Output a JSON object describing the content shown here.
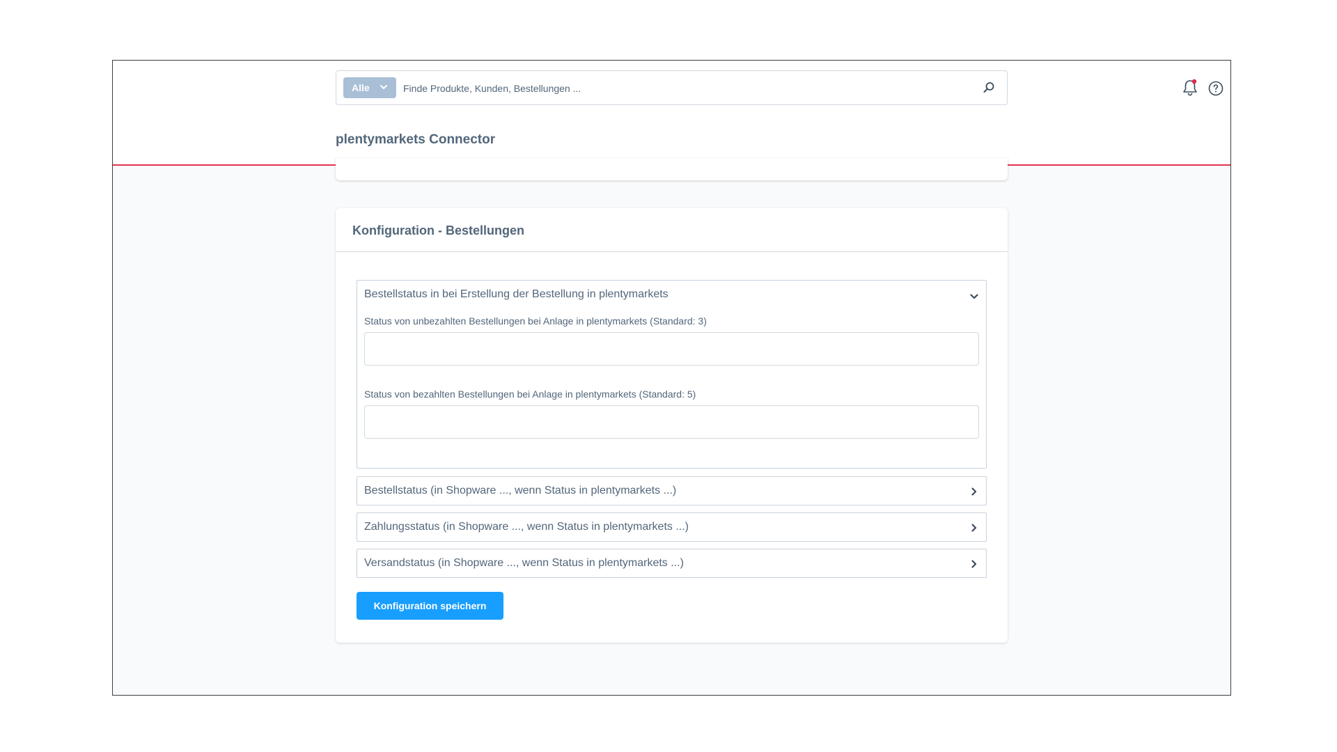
{
  "search": {
    "type_label": "Alle",
    "placeholder": "Finde Produkte, Kunden, Bestellungen ..."
  },
  "module": {
    "title": "plentymarkets Connector"
  },
  "card": {
    "title": "Konfiguration - Bestellungen",
    "open_panel": {
      "title": "Bestellstatus in bei Erstellung der Bestellung in plentymarkets",
      "fields": [
        {
          "label": "Status von unbezahlten Bestellungen bei Anlage in plentymarkets (Standard: 3)",
          "value": ""
        },
        {
          "label": "Status von bezahlten Bestellungen bei Anlage in plentymarkets (Standard: 5)",
          "value": ""
        }
      ]
    },
    "collapsed_panels": [
      {
        "title": "Bestellstatus (in Shopware ..., wenn Status in plentymarkets ...)"
      },
      {
        "title": "Zahlungsstatus (in Shopware ..., wenn Status in plentymarkets ...)"
      },
      {
        "title": "Versandstatus (in Shopware ..., wenn Status in plentymarkets ...)"
      }
    ],
    "save_label": "Konfiguration speichern"
  },
  "colors": {
    "accent": "#189eff",
    "header_border": "#e3334f",
    "notification_dot": "#de294c",
    "text": "#52667a"
  }
}
